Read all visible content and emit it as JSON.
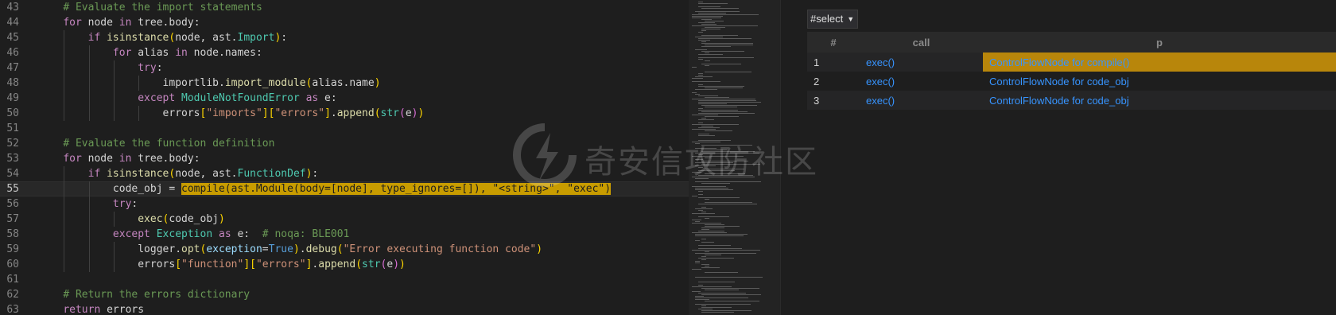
{
  "editor": {
    "lines": [
      {
        "n": "43",
        "indent": 1,
        "tokens": [
          [
            "cm",
            "# Evaluate the import statements"
          ]
        ]
      },
      {
        "n": "44",
        "indent": 1,
        "tokens": [
          [
            "kw",
            "for"
          ],
          [
            "",
            " node "
          ],
          [
            "kw",
            "in"
          ],
          [
            "",
            " tree.body:"
          ]
        ]
      },
      {
        "n": "45",
        "indent": 2,
        "tokens": [
          [
            "kw",
            "if"
          ],
          [
            "",
            " "
          ],
          [
            "fn",
            "isinstance"
          ],
          [
            "br1",
            "("
          ],
          [
            "",
            "node, ast."
          ],
          [
            "cls",
            "Import"
          ],
          [
            "br1",
            ")"
          ],
          [
            "",
            ":"
          ]
        ]
      },
      {
        "n": "46",
        "indent": 3,
        "tokens": [
          [
            "kw",
            "for"
          ],
          [
            "",
            " alias "
          ],
          [
            "kw",
            "in"
          ],
          [
            "",
            " node.names:"
          ]
        ]
      },
      {
        "n": "47",
        "indent": 4,
        "tokens": [
          [
            "kw",
            "try"
          ],
          [
            "",
            ":"
          ]
        ]
      },
      {
        "n": "48",
        "indent": 5,
        "tokens": [
          [
            "",
            "importlib."
          ],
          [
            "fn",
            "import_module"
          ],
          [
            "br1",
            "("
          ],
          [
            "",
            "alias.name"
          ],
          [
            "br1",
            ")"
          ]
        ]
      },
      {
        "n": "49",
        "indent": 4,
        "tokens": [
          [
            "kw",
            "except"
          ],
          [
            "",
            " "
          ],
          [
            "cls",
            "ModuleNotFoundError"
          ],
          [
            "",
            " "
          ],
          [
            "kw",
            "as"
          ],
          [
            "",
            " e:"
          ]
        ]
      },
      {
        "n": "50",
        "indent": 5,
        "tokens": [
          [
            "",
            "errors"
          ],
          [
            "br1",
            "["
          ],
          [
            "str",
            "\"imports\""
          ],
          [
            "br1",
            "]["
          ],
          [
            "str",
            "\"errors\""
          ],
          [
            "br1",
            "]"
          ],
          [
            "",
            "."
          ],
          [
            "fn",
            "append"
          ],
          [
            "br1",
            "("
          ],
          [
            "cls",
            "str"
          ],
          [
            "br2",
            "("
          ],
          [
            "",
            "e"
          ],
          [
            "br2",
            ")"
          ],
          [
            "br1",
            ")"
          ]
        ]
      },
      {
        "n": "51",
        "indent": 0,
        "tokens": []
      },
      {
        "n": "52",
        "indent": 1,
        "tokens": [
          [
            "cm",
            "# Evaluate the function definition"
          ]
        ]
      },
      {
        "n": "53",
        "indent": 1,
        "tokens": [
          [
            "kw",
            "for"
          ],
          [
            "",
            " node "
          ],
          [
            "kw",
            "in"
          ],
          [
            "",
            " tree.body:"
          ]
        ]
      },
      {
        "n": "54",
        "indent": 2,
        "tokens": [
          [
            "kw",
            "if"
          ],
          [
            "",
            " "
          ],
          [
            "fn",
            "isinstance"
          ],
          [
            "br1",
            "("
          ],
          [
            "",
            "node, ast."
          ],
          [
            "cls",
            "FunctionDef"
          ],
          [
            "br1",
            ")"
          ],
          [
            "",
            ":"
          ]
        ]
      },
      {
        "n": "55",
        "indent": 3,
        "current": true,
        "tokens": [
          [
            "",
            "code_obj = "
          ],
          [
            "sel",
            "compile(ast.Module(body=[node], type_ignores=[]), \"<string>\", \"exec\")"
          ]
        ]
      },
      {
        "n": "56",
        "indent": 3,
        "tokens": [
          [
            "kw",
            "try"
          ],
          [
            "",
            ":"
          ]
        ]
      },
      {
        "n": "57",
        "indent": 4,
        "tokens": [
          [
            "fn",
            "exec"
          ],
          [
            "br1",
            "("
          ],
          [
            "",
            "code_obj"
          ],
          [
            "br1",
            ")"
          ]
        ]
      },
      {
        "n": "58",
        "indent": 3,
        "tokens": [
          [
            "kw",
            "except"
          ],
          [
            "",
            " "
          ],
          [
            "cls",
            "Exception"
          ],
          [
            "",
            " "
          ],
          [
            "kw",
            "as"
          ],
          [
            "",
            " e:  "
          ],
          [
            "cm",
            "# noqa: BLE001"
          ]
        ]
      },
      {
        "n": "59",
        "indent": 4,
        "tokens": [
          [
            "",
            "logger."
          ],
          [
            "fn",
            "opt"
          ],
          [
            "br1",
            "("
          ],
          [
            "var",
            "exception"
          ],
          [
            "",
            "="
          ],
          [
            "kwc",
            "True"
          ],
          [
            "br1",
            ")"
          ],
          [
            "",
            "."
          ],
          [
            "fn",
            "debug"
          ],
          [
            "br1",
            "("
          ],
          [
            "str",
            "\"Error executing function code\""
          ],
          [
            "br1",
            ")"
          ]
        ]
      },
      {
        "n": "60",
        "indent": 4,
        "tokens": [
          [
            "",
            "errors"
          ],
          [
            "br1",
            "["
          ],
          [
            "str",
            "\"function\""
          ],
          [
            "br1",
            "]["
          ],
          [
            "str",
            "\"errors\""
          ],
          [
            "br1",
            "]"
          ],
          [
            "",
            "."
          ],
          [
            "fn",
            "append"
          ],
          [
            "br1",
            "("
          ],
          [
            "cls",
            "str"
          ],
          [
            "br2",
            "("
          ],
          [
            "",
            "e"
          ],
          [
            "br2",
            ")"
          ],
          [
            "br1",
            ")"
          ]
        ]
      },
      {
        "n": "61",
        "indent": 0,
        "tokens": []
      },
      {
        "n": "62",
        "indent": 1,
        "tokens": [
          [
            "cm",
            "# Return the errors dictionary"
          ]
        ]
      },
      {
        "n": "63",
        "indent": 1,
        "tokens": [
          [
            "kw",
            "return"
          ],
          [
            "",
            " errors"
          ]
        ]
      }
    ]
  },
  "results": {
    "select_label": "#select",
    "columns": [
      "#",
      "call",
      "p"
    ],
    "rows": [
      {
        "num": "1",
        "call": "exec()",
        "p": "ControlFlowNode for compile()",
        "highlight": true
      },
      {
        "num": "2",
        "call": "exec()",
        "p": "ControlFlowNode for code_obj",
        "highlight": false
      },
      {
        "num": "3",
        "call": "exec()",
        "p": "ControlFlowNode for code_obj",
        "highlight": false
      }
    ]
  },
  "watermark": {
    "text": "奇安信攻防社区"
  },
  "colors": {
    "selection": "#c89c00",
    "highlight_cell": "#b8860b",
    "link": "#3794ff"
  }
}
